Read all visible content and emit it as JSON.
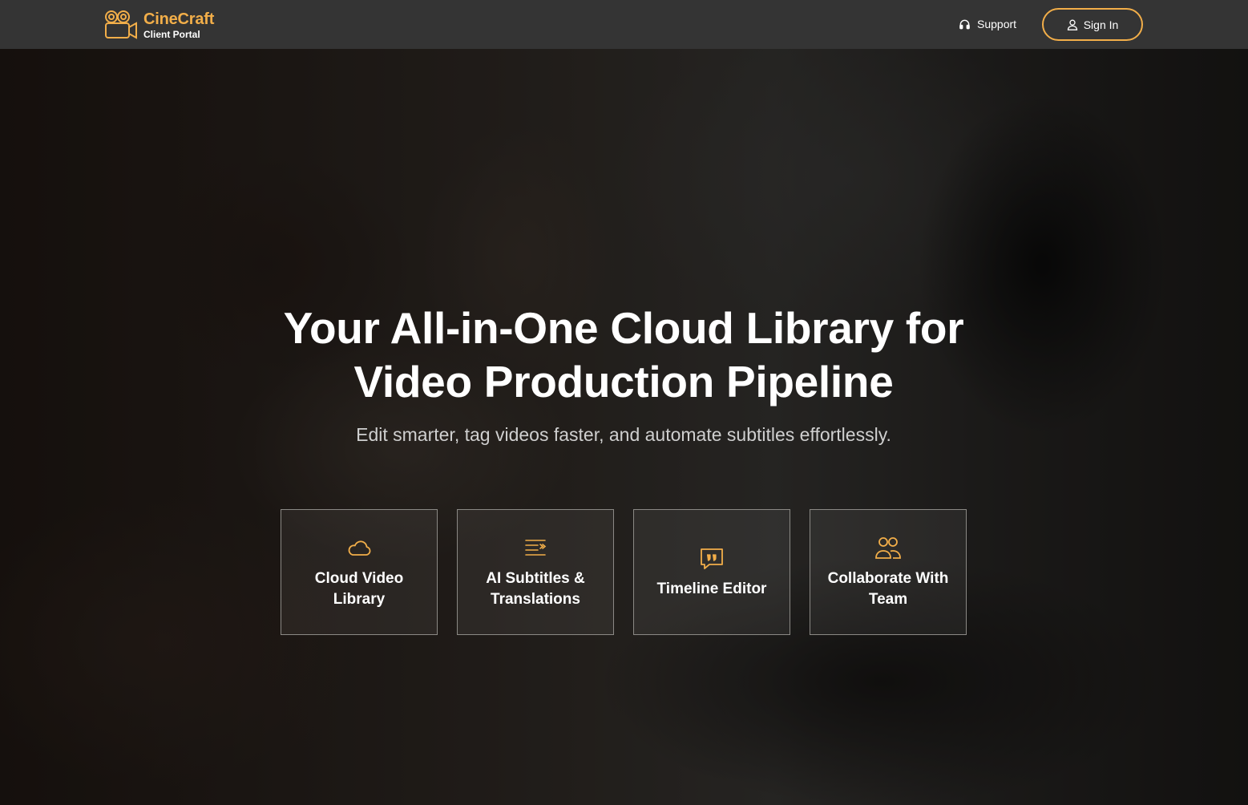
{
  "brand": {
    "name": "CineCraft",
    "subtitle": "Client Portal",
    "logo_icon": "film-camera-icon"
  },
  "nav": {
    "support_label": "Support",
    "support_icon": "headset-icon",
    "signin_label": "Sign In",
    "signin_icon": "user-icon"
  },
  "hero": {
    "title": "Your All-in-One Cloud Library for Video Production Pipeline",
    "subtitle": "Edit smarter, tag videos faster, and automate subtitles effortlessly."
  },
  "features": [
    {
      "label": "Cloud Video Library",
      "icon": "cloud-icon"
    },
    {
      "label": "AI Subtitles & Translations",
      "icon": "subtitles-icon"
    },
    {
      "label": "Timeline Editor",
      "icon": "quote-bubble-icon"
    },
    {
      "label": "Collaborate With Team",
      "icon": "team-icon"
    }
  ],
  "colors": {
    "accent": "#f2ae49",
    "header_bg": "#343434",
    "text_primary": "#ffffff",
    "text_secondary": "#cfcfcf"
  }
}
